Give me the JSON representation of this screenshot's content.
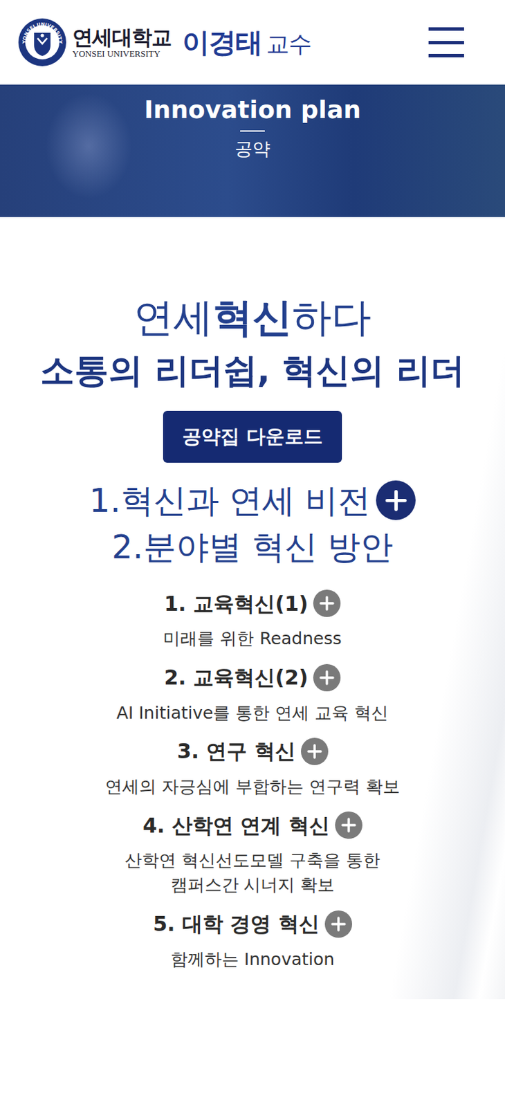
{
  "header": {
    "university_kr": "연세대학교",
    "university_en": "YONSEI UNIVERSITY",
    "candidate": "이경태",
    "candidate_title": "교수",
    "emblem_text": "YONSEI UNIVERSITY"
  },
  "banner": {
    "title": "Innovation plan",
    "subtitle": "공약"
  },
  "hero": {
    "title_parts": [
      {
        "text": "연세",
        "bold": false
      },
      {
        "text": "혁신",
        "bold": true
      },
      {
        "text": "하다",
        "bold": false
      }
    ],
    "slogan": "소통의 리더쉽, 혁신의 리더",
    "download_button": "공약집 다운로드"
  },
  "sections": [
    {
      "label": "1.혁신과 연세 비전",
      "has_toggle": true
    },
    {
      "label": "2.분야별 혁신 방안",
      "has_toggle": false
    }
  ],
  "items": [
    {
      "title": "1. 교육혁신(1)",
      "desc": [
        "미래를 위한 Readness"
      ]
    },
    {
      "title": "2. 교육혁신(2)",
      "desc": [
        "AI Initiative를 통한 연세 교육 혁신"
      ]
    },
    {
      "title": "3. 연구 혁신",
      "desc": [
        "연세의 자긍심에 부합하는 연구력 확보"
      ]
    },
    {
      "title": "4. 산학연 연계 혁신",
      "desc": [
        "산학연 혁신선도모델 구축을 통한",
        "캠퍼스간 시너지 확보"
      ]
    },
    {
      "title": "5. 대학 경영 혁신",
      "desc": [
        "함께하는 Innovation"
      ]
    }
  ]
}
